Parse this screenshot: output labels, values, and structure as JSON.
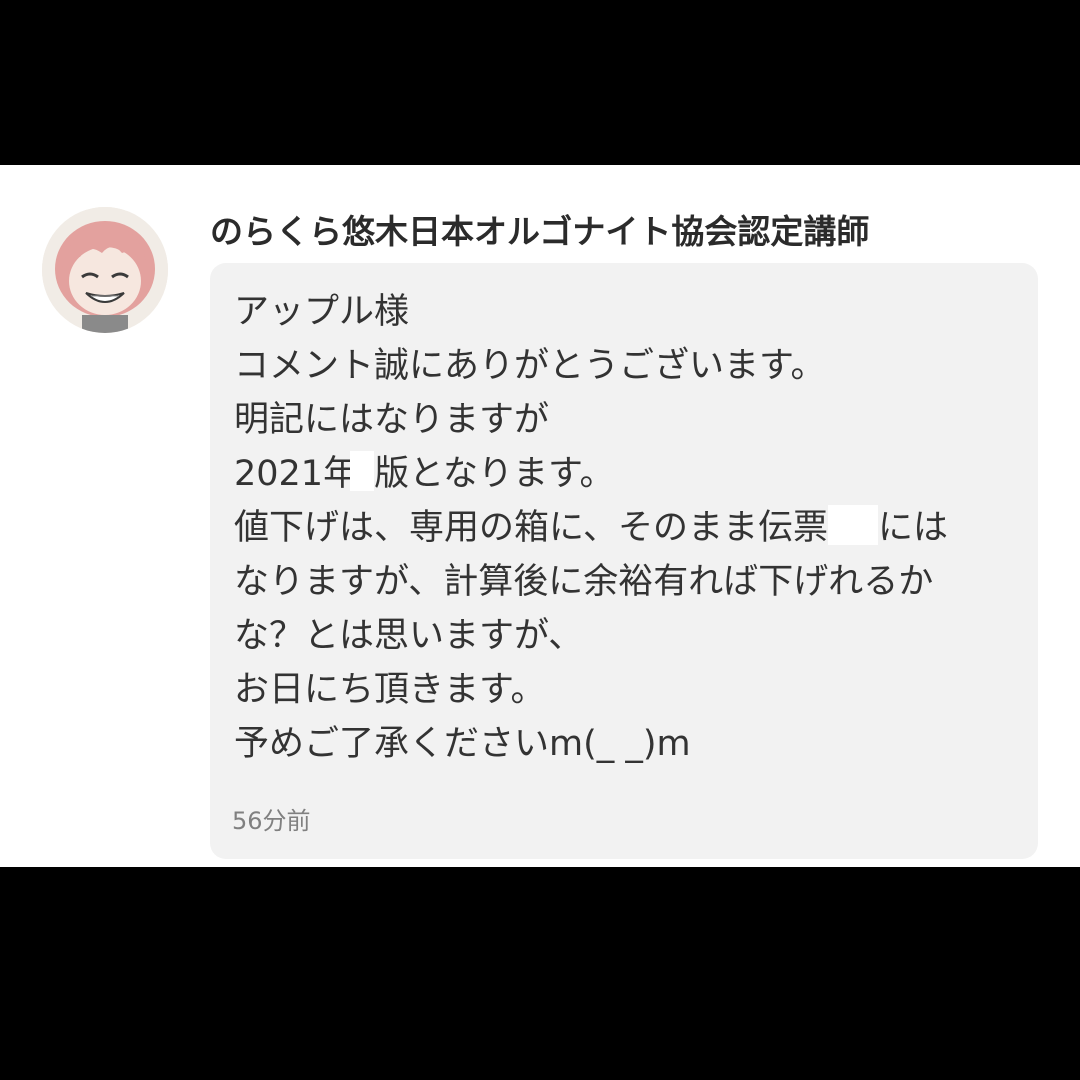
{
  "comment": {
    "author": "のらくら悠木日本オルゴナイト協会認定講師",
    "lines": [
      "アップル様",
      "コメント誠にありがとうございます。",
      "明記にはなりますが"
    ],
    "line4_a": "2021年",
    "line4_b": "版となります。",
    "line5_a": "値下げは、専用の箱に、そのまま伝票",
    "line5_b": "には",
    "lines_after": [
      "なりますが、計算後に余裕有れば下げれるか",
      "な？とは思いますが、",
      "お日にち頂きます。",
      "予めご了承くださいm(_ _)m"
    ],
    "timestamp": "56分前"
  },
  "colors": {
    "background": "#000000",
    "card": "#ffffff",
    "bubble": "#f2f2f2",
    "text": "#333333",
    "timestamp": "#808080",
    "avatar_hair": "#e6a3a0"
  },
  "icons": {
    "avatar": "user-avatar-anime-girl"
  }
}
